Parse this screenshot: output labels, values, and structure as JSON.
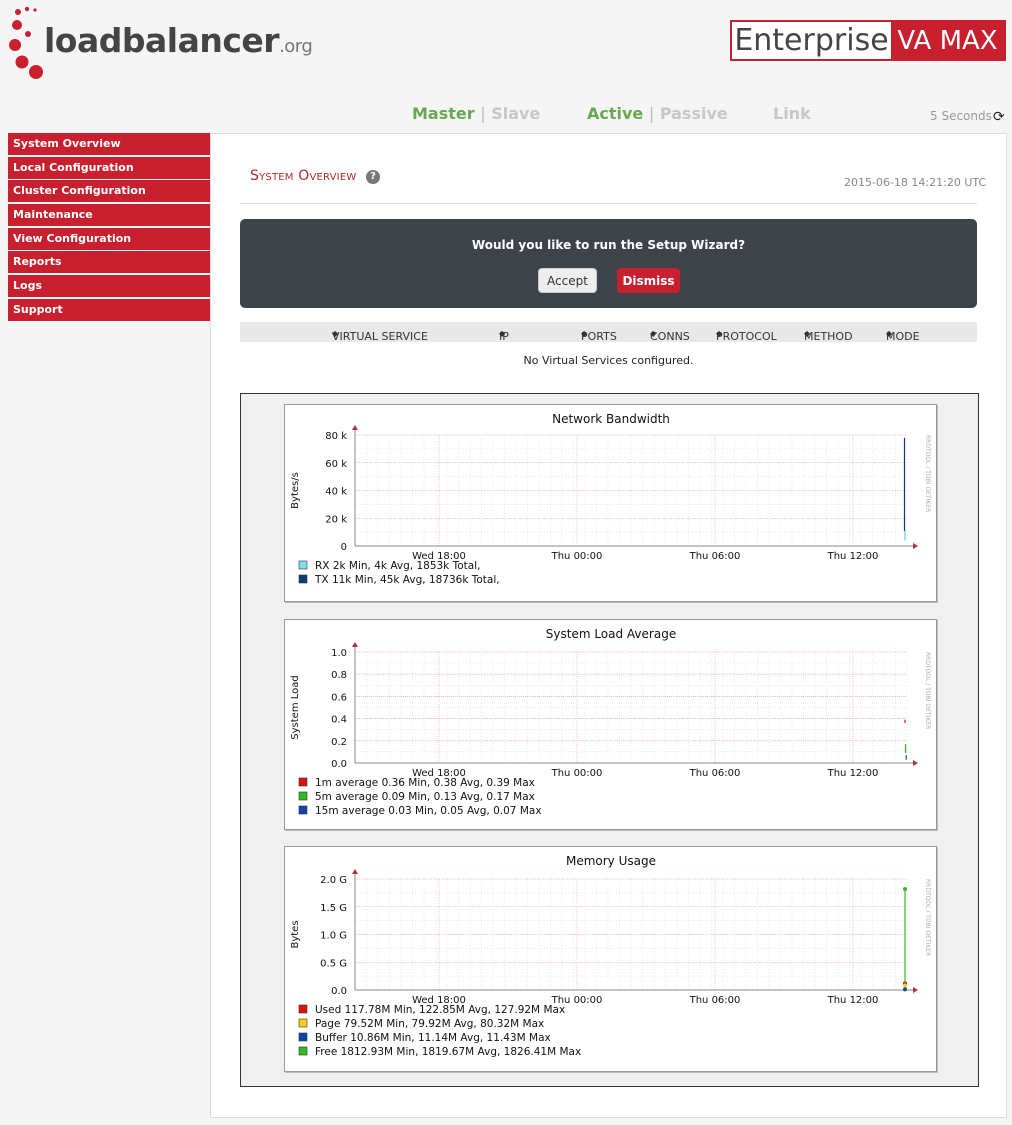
{
  "header": {
    "logo_text": "loadbalancer",
    "logo_suffix": ".org",
    "badge_left": "Enterprise",
    "badge_right": "VA MAX",
    "status": [
      {
        "on": "Master",
        "off": "Slave"
      },
      {
        "on": "Active",
        "off": "Passive"
      }
    ],
    "link": "Link",
    "refresh_text": "5 Seconds"
  },
  "sidebar": {
    "items": [
      {
        "label": "System Overview"
      },
      {
        "label": "Local Configuration"
      },
      {
        "label": "Cluster Configuration"
      },
      {
        "label": "Maintenance"
      },
      {
        "label": "View Configuration"
      },
      {
        "label": "Reports"
      },
      {
        "label": "Logs"
      },
      {
        "label": "Support"
      }
    ]
  },
  "main": {
    "title": "System Overview",
    "help": "?",
    "timestamp": "2015-06-18 14:21:20 UTC",
    "wizard": {
      "question": "Would you like to run the Setup Wizard?",
      "accept": "Accept",
      "dismiss": "Dismiss"
    },
    "vs_columns": [
      "VIRTUAL SERVICE",
      "IP",
      "PORTS",
      "CONNS",
      "PROTOCOL",
      "METHOD",
      "MODE"
    ],
    "sort_glyph": "◆",
    "no_vs": "No Virtual Services configured."
  },
  "chart_data": [
    {
      "type": "line",
      "title": "Network Bandwidth",
      "ylabel": "Bytes/s",
      "watermark": "RRDTOOL / TOBI OETIKER",
      "x_ticks": [
        "Wed 18:00",
        "Thu 00:00",
        "Thu 06:00",
        "Thu 12:00"
      ],
      "y_ticks": [
        "0",
        "20 k",
        "40 k",
        "60 k",
        "80 k"
      ],
      "ylim": [
        0,
        80000
      ],
      "series": [
        {
          "name": "RX",
          "color": "#66ccdd",
          "min": "2k",
          "avg": "4k",
          "total": "1853k",
          "last": 4000
        },
        {
          "name": "TX",
          "color": "#0c3a7a",
          "min": "11k",
          "avg": "45k",
          "total": "18736k",
          "last": 78000
        }
      ],
      "legend": [
        {
          "color": "#88ddee",
          "text": "RX       2k Min,      4k Avg,     1853k Total,"
        },
        {
          "color": "#0c3a7a",
          "text": "TX      11k Min,     45k Avg,    18736k Total,"
        }
      ]
    },
    {
      "type": "line",
      "title": "System Load Average",
      "ylabel": "System Load",
      "watermark": "RRDTOOL / TOBI OETIKER",
      "x_ticks": [
        "Wed 18:00",
        "Thu 00:00",
        "Thu 06:00",
        "Thu 12:00"
      ],
      "y_ticks": [
        "0.0",
        "0.2",
        "0.4",
        "0.6",
        "0.8",
        "1.0"
      ],
      "ylim": [
        0,
        1.0
      ],
      "series": [
        {
          "name": "1m average",
          "color": "#dd1111",
          "min": 0.36,
          "avg": 0.38,
          "max": 0.39
        },
        {
          "name": "5m average",
          "color": "#33bb22",
          "min": 0.09,
          "avg": 0.13,
          "max": 0.17
        },
        {
          "name": "15m average",
          "color": "#1144aa",
          "min": 0.03,
          "avg": 0.05,
          "max": 0.07
        }
      ],
      "legend": [
        {
          "color": "#dd1111",
          "text": "1m average    0.36 Min,    0.38 Avg,    0.39 Max"
        },
        {
          "color": "#33bb22",
          "text": "5m average    0.09 Min,    0.13 Avg,    0.17 Max"
        },
        {
          "color": "#1144aa",
          "text": "15m average    0.03 Min,    0.05 Avg,    0.07 Max"
        }
      ]
    },
    {
      "type": "line",
      "title": "Memory Usage",
      "ylabel": "Bytes",
      "watermark": "RRDTOOL / TOBI OETIKER",
      "x_ticks": [
        "Wed 18:00",
        "Thu 00:00",
        "Thu 06:00",
        "Thu 12:00"
      ],
      "y_ticks": [
        "0.0",
        "0.5 G",
        "1.0 G",
        "1.5 G",
        "2.0 G"
      ],
      "ylim": [
        0,
        2.0
      ],
      "series": [
        {
          "name": "Used",
          "color": "#dd1111",
          "min": "117.78M",
          "avg": "122.85M",
          "max": "127.92M"
        },
        {
          "name": "Page",
          "color": "#ffcc11",
          "min": "79.52M",
          "avg": "79.92M",
          "max": "80.32M"
        },
        {
          "name": "Buffer",
          "color": "#1144aa",
          "min": "10.86M",
          "avg": "11.14M",
          "max": "11.43M"
        },
        {
          "name": "Free",
          "color": "#33bb22",
          "min": "1812.93M",
          "avg": "1819.67M",
          "max": "1826.41M"
        }
      ],
      "legend": [
        {
          "color": "#dd1111",
          "text": "Used      117.78M Min,     122.85M Avg,     127.92M Max"
        },
        {
          "color": "#ffcc11",
          "text": "Page       79.52M Min,     79.92M Avg,     80.32M Max"
        },
        {
          "color": "#1144aa",
          "text": "Buffer    10.86M Min,     11.14M Avg,     11.43M Max"
        },
        {
          "color": "#33bb22",
          "text": "Free     1812.93M Min,     1819.67M Avg,     1826.41M Max"
        }
      ]
    }
  ]
}
